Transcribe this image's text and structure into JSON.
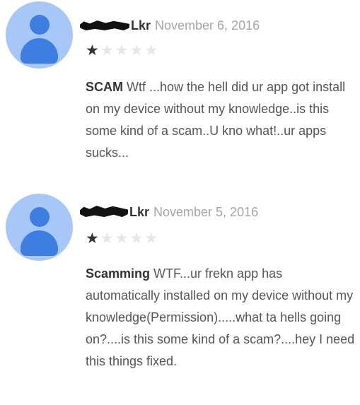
{
  "reviews": [
    {
      "author_suffix": "Lkr",
      "date": "November 6, 2016",
      "rating": 1,
      "max_rating": 5,
      "title": "SCAM",
      "text": "Wtf ...how the hell did ur app got install on my device without my knowledge..is this some kind of a scam..U kno what!..ur apps sucks..."
    },
    {
      "author_suffix": "Lkr",
      "date": "November 5, 2016",
      "rating": 1,
      "max_rating": 5,
      "title": "Scamming",
      "text": "WTF...ur frekn app has automatically installed on my device without my knowledge(Permission).....what ta hells going on?....is this some kind of a scam?....hey I need this things fixed."
    }
  ],
  "icons": {
    "avatar": "user-avatar-icon",
    "star": "star-icon"
  },
  "colors": {
    "avatar_bg": "#a7c7f7",
    "avatar_fg": "#3d7fe0",
    "star_filled": "#333333",
    "star_empty": "#e6e6e6",
    "date": "#a5a5a5"
  }
}
